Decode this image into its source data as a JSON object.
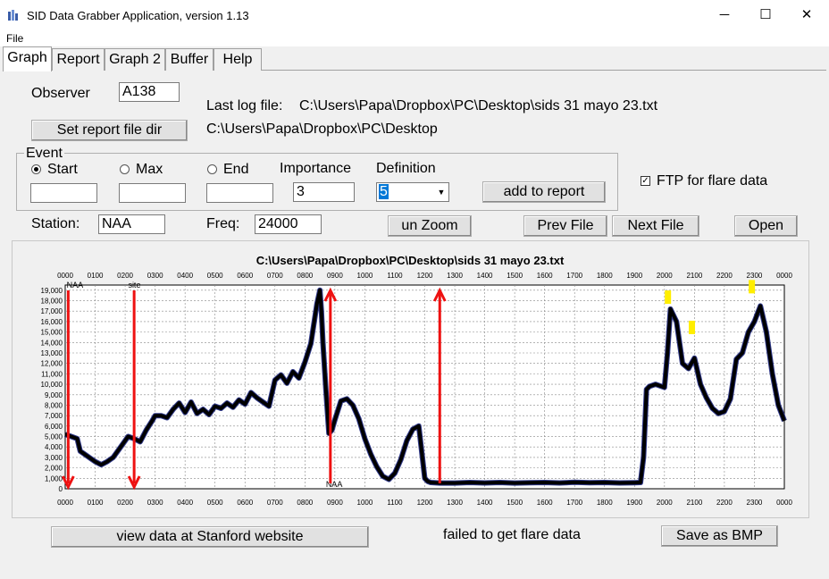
{
  "window": {
    "title": "SID Data Grabber Application, version 1.13",
    "minimize": "─",
    "maximize": "☐",
    "close": "✕"
  },
  "menu": {
    "file": "File"
  },
  "tabs": [
    "Graph",
    "Report",
    "Graph 2",
    "Buffer",
    "Help"
  ],
  "form": {
    "observer_label": "Observer",
    "observer_value": "A138",
    "last_log_label": "Last log file:",
    "last_log_value": "C:\\Users\\Papa\\Dropbox\\PC\\Desktop\\sids 31 mayo 23.txt",
    "set_report_dir": "Set report file dir",
    "report_dir_value": "C:\\Users\\Papa\\Dropbox\\PC\\Desktop",
    "event_label": "Event",
    "start_label": "Start",
    "max_label": "Max",
    "end_label": "End",
    "start_value": "",
    "max_value": "",
    "end_value": "",
    "importance_label": "Importance",
    "importance_value": "3",
    "definition_label": "Definition",
    "definition_value": "5",
    "add_to_report": "add to report",
    "ftp_label": "FTP for flare data",
    "station_label": "Station:",
    "station_value": "NAA",
    "freq_label": "Freq:",
    "freq_value": "24000",
    "unzoom": "un Zoom",
    "prev_file": "Prev File",
    "next_file": "Next File",
    "open": "Open",
    "view_stanford": "view data at Stanford website",
    "flare_status": "failed to get flare data",
    "save_bmp": "Save as BMP"
  },
  "chart_data": {
    "type": "line",
    "title": "C:\\Users\\Papa\\Dropbox\\PC\\Desktop\\sids 31 mayo 23.txt",
    "x_tick_labels": [
      "0000",
      "0100",
      "0200",
      "0300",
      "0400",
      "0500",
      "0600",
      "0700",
      "0800",
      "0900",
      "1000",
      "1100",
      "1200",
      "1300",
      "1400",
      "1500",
      "1600",
      "1700",
      "1800",
      "1900",
      "2000",
      "2100",
      "2200",
      "2300",
      "0000"
    ],
    "y_tick_labels": [
      "0",
      "1,000",
      "2,000",
      "3,000",
      "4,000",
      "5,000",
      "6,000",
      "7,000",
      "8,000",
      "9,000",
      "10,000",
      "11,000",
      "12,000",
      "13,000",
      "14,000",
      "15,000",
      "16,000",
      "17,000",
      "18,000",
      "19,000"
    ],
    "ylim": [
      0,
      19500
    ],
    "xlim": [
      0,
      24
    ],
    "grid": true,
    "annotations": [
      "NAA",
      "site",
      "NAA"
    ],
    "series": [
      {
        "values_x": [
          0,
          0.2,
          0.4,
          0.5,
          0.6,
          0.8,
          1.0,
          1.2,
          1.4,
          1.6,
          1.8,
          2.0,
          2.1,
          2.3,
          2.5,
          2.7,
          2.9,
          3.0,
          3.2,
          3.4,
          3.6,
          3.8,
          4.0,
          4.2,
          4.4,
          4.6,
          4.8,
          5.0,
          5.2,
          5.4,
          5.6,
          5.8,
          6.0,
          6.2,
          6.4,
          6.6,
          6.8,
          7.0,
          7.2,
          7.4,
          7.6,
          7.8,
          8.0,
          8.2,
          8.4,
          8.5,
          8.55,
          8.6,
          8.7,
          8.8,
          8.9,
          9.0,
          9.2,
          9.4,
          9.6,
          9.8,
          10.0,
          10.2,
          10.4,
          10.6,
          10.8,
          11.0,
          11.2,
          11.4,
          11.6,
          11.8,
          12.0,
          12.1,
          12.2,
          12.5,
          13.0,
          13.5,
          14.0,
          14.5,
          15.0,
          15.5,
          16.0,
          16.5,
          17.0,
          17.5,
          18.0,
          18.5,
          19.0,
          19.2,
          19.3,
          19.4,
          19.5,
          19.7,
          19.9,
          20.0,
          20.1,
          20.2,
          20.4,
          20.6,
          20.8,
          21.0,
          21.2,
          21.4,
          21.6,
          21.8,
          22.0,
          22.2,
          22.4,
          22.6,
          22.8,
          23.0,
          23.2,
          23.4,
          23.6,
          23.8,
          24.0
        ],
        "values_y": [
          5200,
          5000,
          4800,
          3600,
          3400,
          3000,
          2600,
          2300,
          2600,
          3000,
          3800,
          4600,
          5000,
          4800,
          4500,
          5600,
          6500,
          7000,
          7000,
          6800,
          7600,
          8200,
          7300,
          8300,
          7200,
          7600,
          7100,
          7900,
          7700,
          8200,
          7800,
          8500,
          8100,
          9200,
          8700,
          8300,
          7900,
          10400,
          10900,
          10100,
          11200,
          10600,
          12100,
          13900,
          17700,
          19000,
          17000,
          14000,
          9500,
          5300,
          5600,
          6600,
          8400,
          8600,
          8000,
          6700,
          4800,
          3300,
          2100,
          1200,
          900,
          1500,
          2800,
          4600,
          5700,
          6000,
          1000,
          700,
          600,
          550,
          550,
          600,
          560,
          600,
          550,
          580,
          600,
          560,
          620,
          580,
          600,
          560,
          580,
          600,
          3000,
          9500,
          9800,
          10000,
          9800,
          9700,
          13000,
          17200,
          16000,
          12000,
          11500,
          12500,
          10000,
          8700,
          7700,
          7200,
          7400,
          8600,
          12400,
          13000,
          15000,
          16000,
          17500,
          15000,
          11000,
          8000,
          6500
        ]
      }
    ],
    "markers_down_at": [
      0.1,
      2.3
    ],
    "markers_up_at": [
      8.85,
      12.5
    ],
    "flare_markers": [
      {
        "x": 20.1,
        "y": 18300
      },
      {
        "x": 20.9,
        "y": 15400
      },
      {
        "x": 22.9,
        "y": 19300
      }
    ],
    "colors": {
      "line": "#000000",
      "points": "#1a237e",
      "marker": "#ee1111",
      "flare": "#ffee00",
      "grid": "#888888"
    }
  }
}
